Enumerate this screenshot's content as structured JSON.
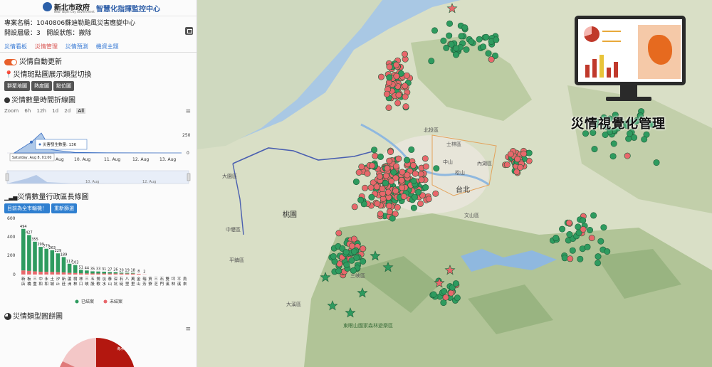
{
  "header": {
    "logo_text": "新北市政府",
    "logo_sub": "New Taipei City Government",
    "app_title": "智慧化指揮監控中心"
  },
  "project": {
    "name_label": "專案名稱：",
    "name_value": "1040806蘇迪勒颱風災害應變中心",
    "level_label": "開設層級：",
    "level_value": "3",
    "status_label": "開設狀態：",
    "status_value": "撤除"
  },
  "tabs": [
    "災情看板",
    "災情管理",
    "災情預測",
    "機資主題"
  ],
  "auto_update": {
    "label": "災情自動更新"
  },
  "point_type": {
    "title": "災情斑點圖展示類型切換",
    "buttons": [
      "群聚地圖",
      "熱度圖",
      "點位圖"
    ]
  },
  "timeline": {
    "title": "災情數量時間折線圖",
    "zoom_label": "Zoom",
    "zoom_options": [
      "6h",
      "12h",
      "1d",
      "2d",
      "All"
    ],
    "y_ticks": [
      "250",
      "0"
    ],
    "x_ticks": [
      "Aug",
      "10. Aug",
      "11. Aug",
      "12. Aug",
      "13. Aug"
    ],
    "nav_ticks": [
      "10. Aug",
      "12. Aug"
    ],
    "tooltip_date": "Saturday, Aug 8, 01:00",
    "tooltip_series": "災害發生數量",
    "tooltip_value": "136"
  },
  "district_chart": {
    "title": "災情數量行政區長條圖",
    "btn_primary": "目前為全市輸機！",
    "btn_reset": "重新篩選",
    "y_ticks": [
      "600",
      "400",
      "200",
      "0"
    ],
    "legend": [
      "已結案",
      "未結案"
    ]
  },
  "pie_chart": {
    "title": "災情類型圓餅圖",
    "label": "淹水"
  },
  "map": {
    "viz_label": "災情視覺化管理",
    "places": [
      "北投區",
      "士林區",
      "中山",
      "內湖區",
      "松山",
      "台北",
      "文山區",
      "大園區",
      "桃園",
      "中壢區",
      "平鎮區",
      "大溪區",
      "三峽區",
      "東眼山國家森林遊樂區"
    ]
  },
  "colors": {
    "closed": "#2e9b5f",
    "open": "#e8676b",
    "accent": "#e8602c"
  },
  "chart_data": [
    {
      "type": "line",
      "title": "災情數量時間折線圖",
      "series": [
        {
          "name": "災害發生數量",
          "values": [
            0,
            136,
            250,
            40,
            6,
            2,
            1,
            0
          ]
        }
      ],
      "x": [
        "Aug 7",
        "Aug 8 01:00",
        "Aug 8",
        "Aug 9",
        "Aug 10",
        "Aug 11",
        "Aug 12",
        "Aug 13"
      ],
      "ylim": [
        0,
        250
      ]
    },
    {
      "type": "bar",
      "title": "災情數量行政區長條圖",
      "categories": [
        "新店",
        "板橋",
        "三重",
        "中和",
        "永和",
        "土城",
        "汐止",
        "新莊",
        "蘆洲",
        "樹林",
        "林口",
        "三峽",
        "五股",
        "鶯歌",
        "淡水",
        "泰山",
        "深坑",
        "石碇",
        "八里",
        "萬里",
        "金山",
        "瑞芳",
        "貢寮",
        "三芝",
        "石門",
        "雙溪",
        "坪林",
        "平溪",
        "烏來"
      ],
      "values": [
        494,
        427,
        355,
        299,
        279,
        263,
        229,
        189,
        117,
        103,
        51,
        44,
        35,
        33,
        31,
        27,
        26,
        20,
        19,
        18,
        8,
        2,
        0,
        0,
        0,
        0,
        0,
        0,
        0
      ],
      "series": [
        {
          "name": "已結案"
        },
        {
          "name": "未結案"
        }
      ],
      "ylim": [
        0,
        600
      ]
    },
    {
      "type": "pie",
      "title": "災情類型圓餅圖",
      "categories": [
        "淹水"
      ]
    }
  ]
}
